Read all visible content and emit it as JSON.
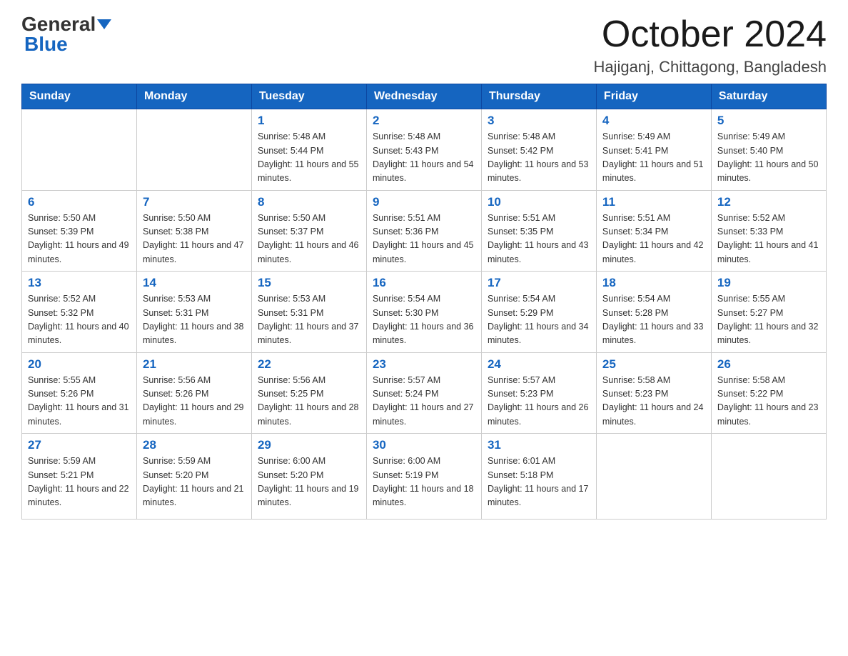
{
  "logo": {
    "part1": "General",
    "part2": "Blue"
  },
  "header": {
    "month_title": "October 2024",
    "location": "Hajiganj, Chittagong, Bangladesh"
  },
  "weekdays": [
    "Sunday",
    "Monday",
    "Tuesday",
    "Wednesday",
    "Thursday",
    "Friday",
    "Saturday"
  ],
  "weeks": [
    [
      null,
      null,
      {
        "day": "1",
        "sunrise": "Sunrise: 5:48 AM",
        "sunset": "Sunset: 5:44 PM",
        "daylight": "Daylight: 11 hours and 55 minutes."
      },
      {
        "day": "2",
        "sunrise": "Sunrise: 5:48 AM",
        "sunset": "Sunset: 5:43 PM",
        "daylight": "Daylight: 11 hours and 54 minutes."
      },
      {
        "day": "3",
        "sunrise": "Sunrise: 5:48 AM",
        "sunset": "Sunset: 5:42 PM",
        "daylight": "Daylight: 11 hours and 53 minutes."
      },
      {
        "day": "4",
        "sunrise": "Sunrise: 5:49 AM",
        "sunset": "Sunset: 5:41 PM",
        "daylight": "Daylight: 11 hours and 51 minutes."
      },
      {
        "day": "5",
        "sunrise": "Sunrise: 5:49 AM",
        "sunset": "Sunset: 5:40 PM",
        "daylight": "Daylight: 11 hours and 50 minutes."
      }
    ],
    [
      {
        "day": "6",
        "sunrise": "Sunrise: 5:50 AM",
        "sunset": "Sunset: 5:39 PM",
        "daylight": "Daylight: 11 hours and 49 minutes."
      },
      {
        "day": "7",
        "sunrise": "Sunrise: 5:50 AM",
        "sunset": "Sunset: 5:38 PM",
        "daylight": "Daylight: 11 hours and 47 minutes."
      },
      {
        "day": "8",
        "sunrise": "Sunrise: 5:50 AM",
        "sunset": "Sunset: 5:37 PM",
        "daylight": "Daylight: 11 hours and 46 minutes."
      },
      {
        "day": "9",
        "sunrise": "Sunrise: 5:51 AM",
        "sunset": "Sunset: 5:36 PM",
        "daylight": "Daylight: 11 hours and 45 minutes."
      },
      {
        "day": "10",
        "sunrise": "Sunrise: 5:51 AM",
        "sunset": "Sunset: 5:35 PM",
        "daylight": "Daylight: 11 hours and 43 minutes."
      },
      {
        "day": "11",
        "sunrise": "Sunrise: 5:51 AM",
        "sunset": "Sunset: 5:34 PM",
        "daylight": "Daylight: 11 hours and 42 minutes."
      },
      {
        "day": "12",
        "sunrise": "Sunrise: 5:52 AM",
        "sunset": "Sunset: 5:33 PM",
        "daylight": "Daylight: 11 hours and 41 minutes."
      }
    ],
    [
      {
        "day": "13",
        "sunrise": "Sunrise: 5:52 AM",
        "sunset": "Sunset: 5:32 PM",
        "daylight": "Daylight: 11 hours and 40 minutes."
      },
      {
        "day": "14",
        "sunrise": "Sunrise: 5:53 AM",
        "sunset": "Sunset: 5:31 PM",
        "daylight": "Daylight: 11 hours and 38 minutes."
      },
      {
        "day": "15",
        "sunrise": "Sunrise: 5:53 AM",
        "sunset": "Sunset: 5:31 PM",
        "daylight": "Daylight: 11 hours and 37 minutes."
      },
      {
        "day": "16",
        "sunrise": "Sunrise: 5:54 AM",
        "sunset": "Sunset: 5:30 PM",
        "daylight": "Daylight: 11 hours and 36 minutes."
      },
      {
        "day": "17",
        "sunrise": "Sunrise: 5:54 AM",
        "sunset": "Sunset: 5:29 PM",
        "daylight": "Daylight: 11 hours and 34 minutes."
      },
      {
        "day": "18",
        "sunrise": "Sunrise: 5:54 AM",
        "sunset": "Sunset: 5:28 PM",
        "daylight": "Daylight: 11 hours and 33 minutes."
      },
      {
        "day": "19",
        "sunrise": "Sunrise: 5:55 AM",
        "sunset": "Sunset: 5:27 PM",
        "daylight": "Daylight: 11 hours and 32 minutes."
      }
    ],
    [
      {
        "day": "20",
        "sunrise": "Sunrise: 5:55 AM",
        "sunset": "Sunset: 5:26 PM",
        "daylight": "Daylight: 11 hours and 31 minutes."
      },
      {
        "day": "21",
        "sunrise": "Sunrise: 5:56 AM",
        "sunset": "Sunset: 5:26 PM",
        "daylight": "Daylight: 11 hours and 29 minutes."
      },
      {
        "day": "22",
        "sunrise": "Sunrise: 5:56 AM",
        "sunset": "Sunset: 5:25 PM",
        "daylight": "Daylight: 11 hours and 28 minutes."
      },
      {
        "day": "23",
        "sunrise": "Sunrise: 5:57 AM",
        "sunset": "Sunset: 5:24 PM",
        "daylight": "Daylight: 11 hours and 27 minutes."
      },
      {
        "day": "24",
        "sunrise": "Sunrise: 5:57 AM",
        "sunset": "Sunset: 5:23 PM",
        "daylight": "Daylight: 11 hours and 26 minutes."
      },
      {
        "day": "25",
        "sunrise": "Sunrise: 5:58 AM",
        "sunset": "Sunset: 5:23 PM",
        "daylight": "Daylight: 11 hours and 24 minutes."
      },
      {
        "day": "26",
        "sunrise": "Sunrise: 5:58 AM",
        "sunset": "Sunset: 5:22 PM",
        "daylight": "Daylight: 11 hours and 23 minutes."
      }
    ],
    [
      {
        "day": "27",
        "sunrise": "Sunrise: 5:59 AM",
        "sunset": "Sunset: 5:21 PM",
        "daylight": "Daylight: 11 hours and 22 minutes."
      },
      {
        "day": "28",
        "sunrise": "Sunrise: 5:59 AM",
        "sunset": "Sunset: 5:20 PM",
        "daylight": "Daylight: 11 hours and 21 minutes."
      },
      {
        "day": "29",
        "sunrise": "Sunrise: 6:00 AM",
        "sunset": "Sunset: 5:20 PM",
        "daylight": "Daylight: 11 hours and 19 minutes."
      },
      {
        "day": "30",
        "sunrise": "Sunrise: 6:00 AM",
        "sunset": "Sunset: 5:19 PM",
        "daylight": "Daylight: 11 hours and 18 minutes."
      },
      {
        "day": "31",
        "sunrise": "Sunrise: 6:01 AM",
        "sunset": "Sunset: 5:18 PM",
        "daylight": "Daylight: 11 hours and 17 minutes."
      },
      null,
      null
    ]
  ]
}
